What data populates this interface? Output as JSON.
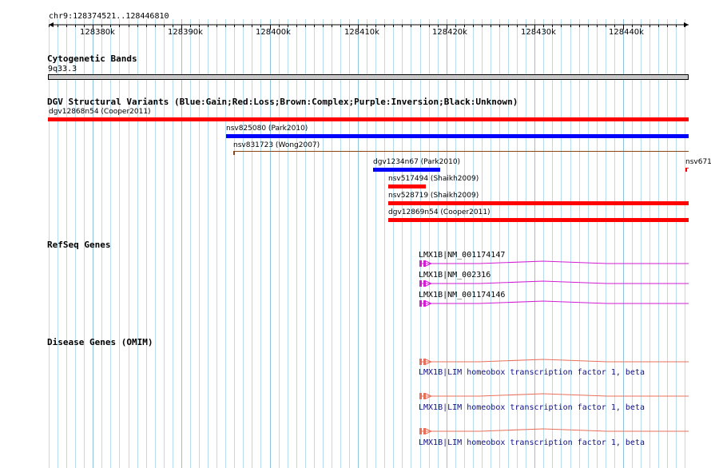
{
  "ruler": {
    "range_label": "chr9:128374521..128446810",
    "ticks": [
      "128380k",
      "128390k",
      "128400k",
      "128410k",
      "128420k",
      "128430k",
      "128440k"
    ]
  },
  "cytoband": {
    "title": "Cytogenetic Bands",
    "band": "9q33.3"
  },
  "dgv": {
    "title": "DGV Structural Variants (Blue:Gain;Red:Loss;Brown:Complex;Purple:Inversion;Black:Unknown)",
    "colors": {
      "gain": "#0000ff",
      "loss": "#ff0000",
      "complex": "#8b4513"
    },
    "features": [
      {
        "label": "dgv12868n54 (Cooper2011)",
        "type": "loss"
      },
      {
        "label": "nsv825080 (Park2010)",
        "type": "gain"
      },
      {
        "label": "nsv831723 (Wong2007)",
        "type": "complex"
      },
      {
        "label": "dgv1234n67 (Park2010)",
        "type": "gain"
      },
      {
        "label": "nsv671",
        "type": "loss"
      },
      {
        "label": "nsv517494 (Shaikh2009)",
        "type": "loss"
      },
      {
        "label": "nsv528719 (Shaikh2009)",
        "type": "loss"
      },
      {
        "label": "dgv12869n54 (Cooper2011)",
        "type": "loss"
      }
    ]
  },
  "refseq": {
    "title": "RefSeq Genes",
    "color": "#d21ed2",
    "genes": [
      {
        "label": "LMX1B|NM_001174147"
      },
      {
        "label": "LMX1B|NM_002316"
      },
      {
        "label": "LMX1B|NM_001174146"
      }
    ]
  },
  "omim": {
    "title": "Disease Genes (OMIM)",
    "color": "#e8705a",
    "genes": [
      {
        "label": "LMX1B|LIM homeobox transcription factor 1, beta"
      },
      {
        "label": "LMX1B|LIM homeobox transcription factor 1, beta"
      },
      {
        "label": "LMX1B|LIM homeobox transcription factor 1, beta"
      }
    ]
  }
}
